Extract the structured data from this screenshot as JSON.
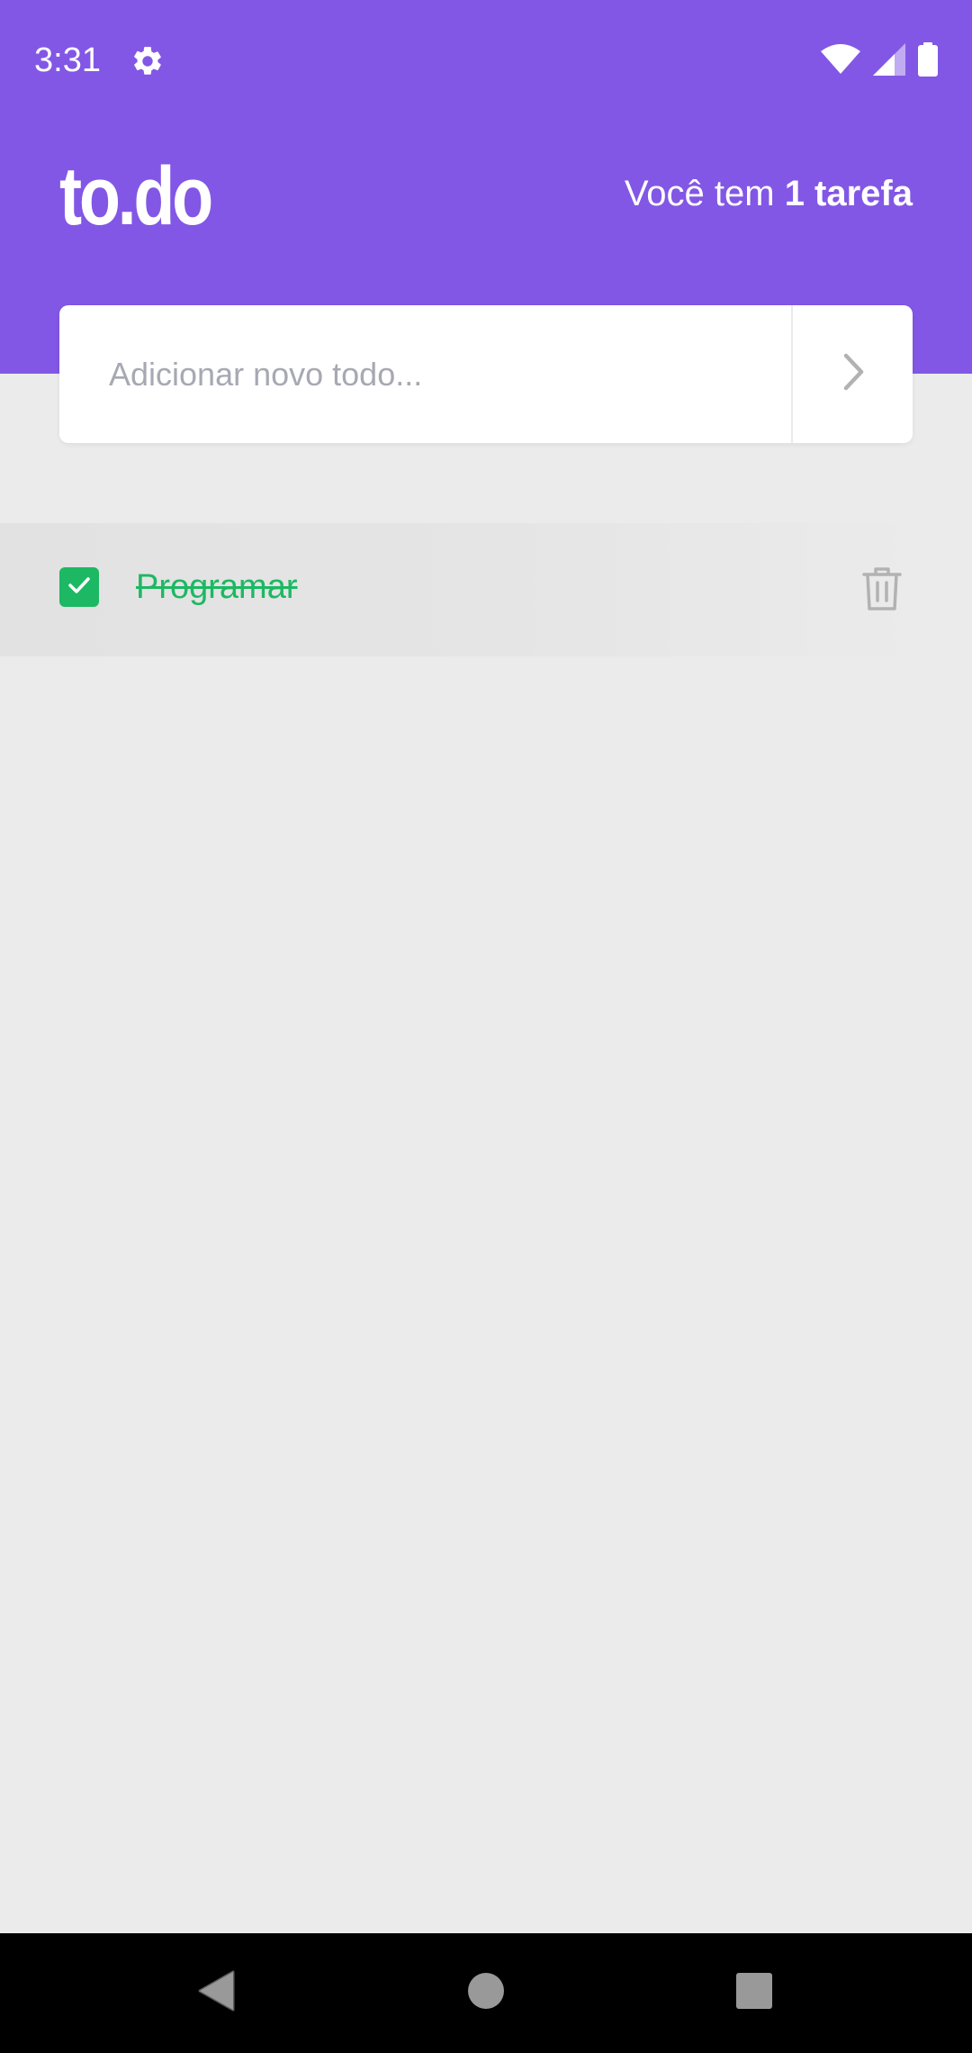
{
  "status_bar": {
    "time": "3:31",
    "icons": [
      "gear-icon",
      "wifi-icon",
      "signal-icon",
      "battery-icon"
    ]
  },
  "header": {
    "logo": "to.do",
    "count_prefix": "Você tem ",
    "count_value": "1 tarefa"
  },
  "new_todo": {
    "placeholder": "Adicionar novo todo...",
    "value": "",
    "submit_icon": "chevron-right-icon"
  },
  "tasks": [
    {
      "title": "Programar",
      "done": true,
      "delete_icon": "trash-icon"
    }
  ],
  "nav_bar": {
    "buttons": [
      "back-icon",
      "home-icon",
      "recents-icon"
    ]
  },
  "colors": {
    "header_bg": "#8257E5",
    "page_bg": "#EBEBEB",
    "done_green": "#1DB863",
    "placeholder": "#A8A8B3",
    "icon_gray": "#B2B2B2"
  }
}
